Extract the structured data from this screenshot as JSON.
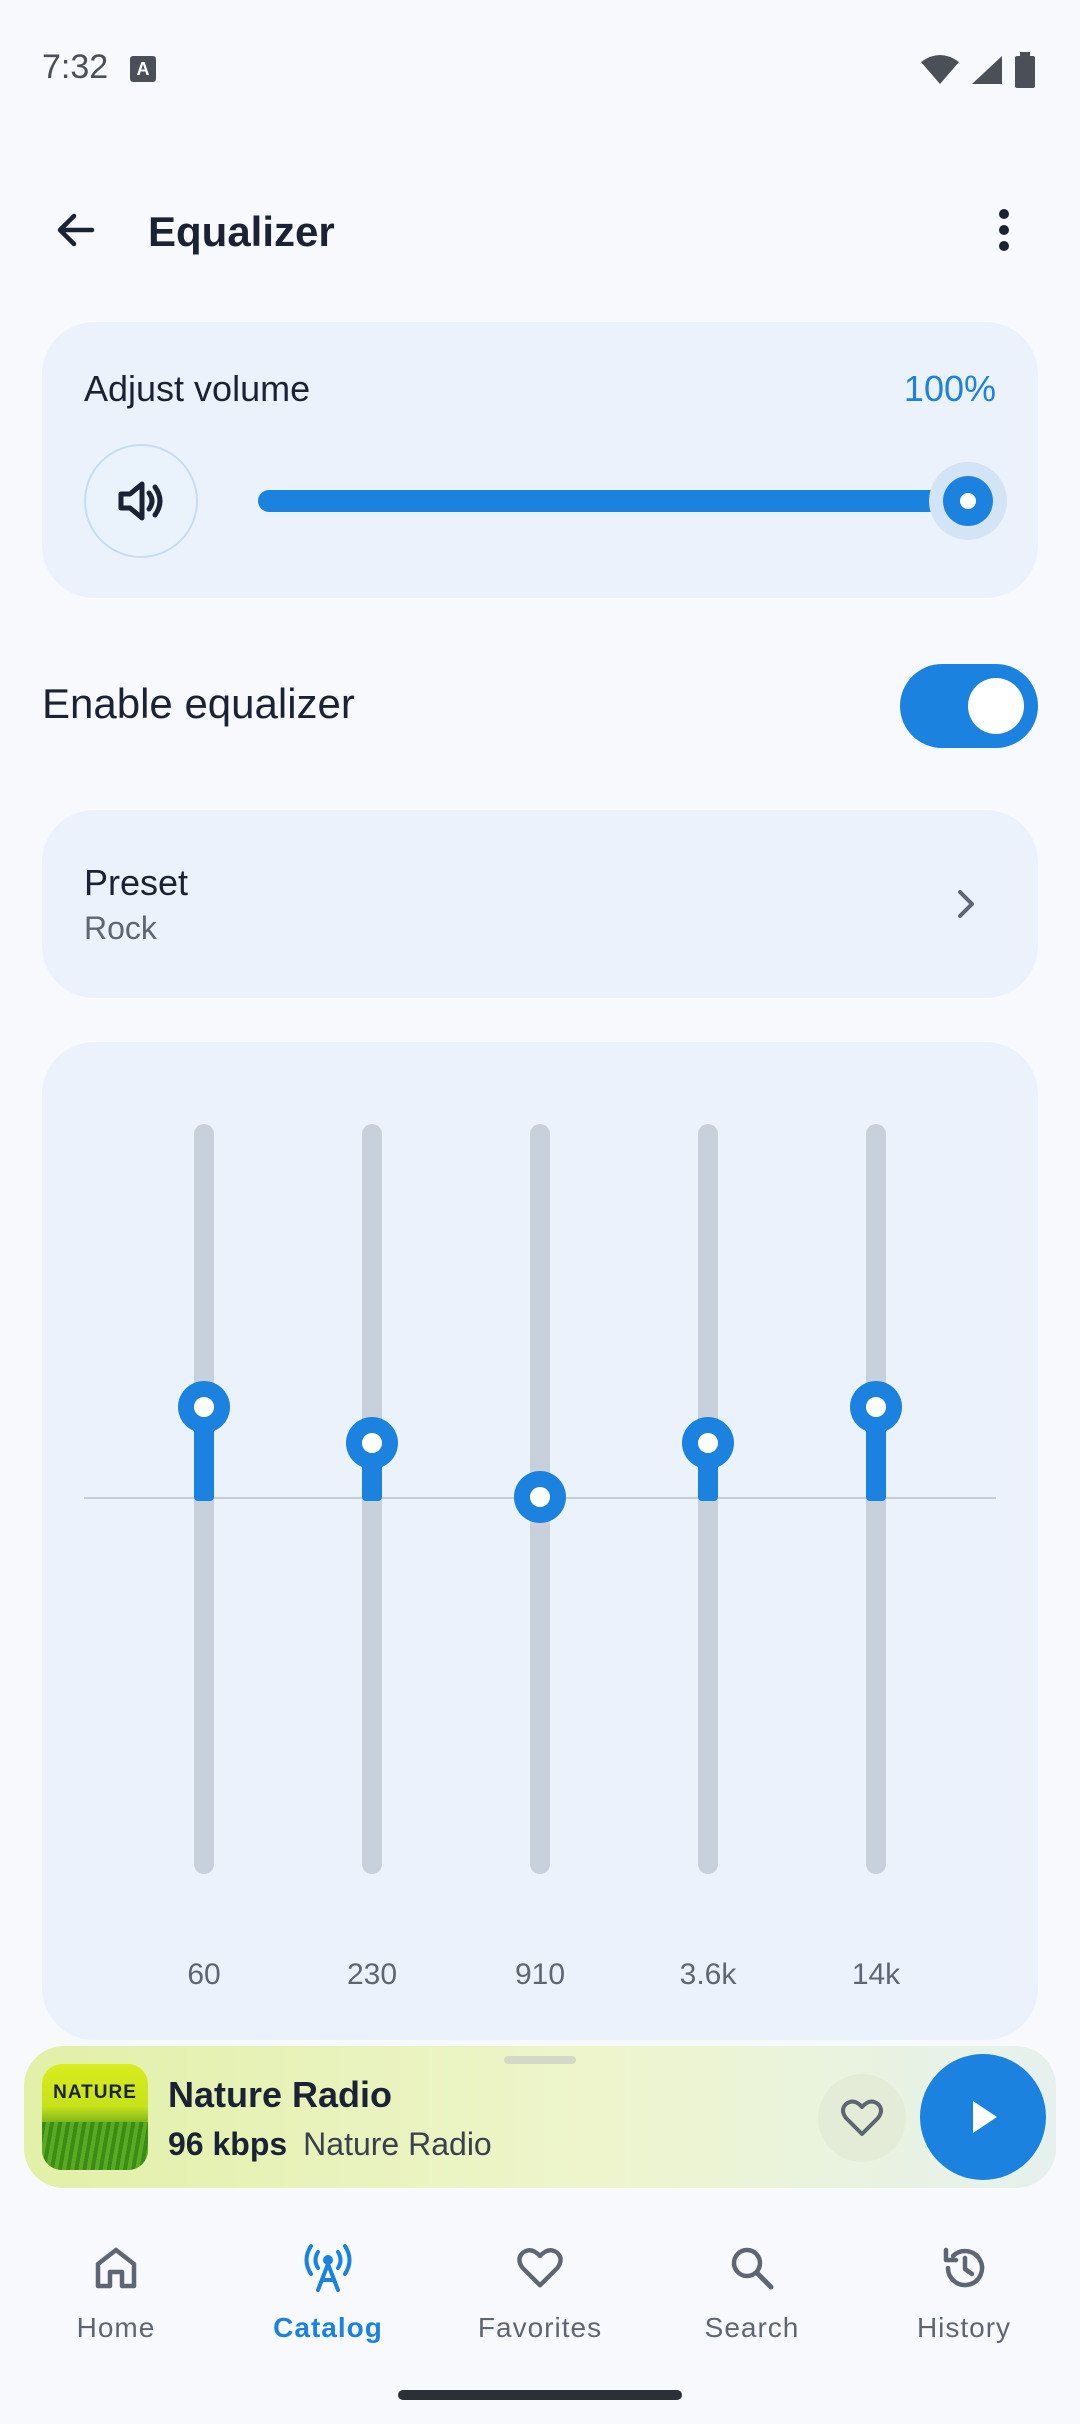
{
  "status_bar": {
    "time": "7:32",
    "notification_badge": "A"
  },
  "app_bar": {
    "title": "Equalizer"
  },
  "volume": {
    "label": "Adjust volume",
    "value_text": "100%",
    "level": 1.0
  },
  "equalizer_toggle": {
    "label": "Enable equalizer",
    "enabled": true
  },
  "preset": {
    "title": "Preset",
    "value": "Rock"
  },
  "bands": [
    {
      "label": "60",
      "level": 0.25
    },
    {
      "label": "230",
      "level": 0.15
    },
    {
      "label": "910",
      "level": 0.0
    },
    {
      "label": "3.6k",
      "level": 0.15
    },
    {
      "label": "14k",
      "level": 0.25
    }
  ],
  "player": {
    "artwork_text": "NATURE",
    "title": "Nature Radio",
    "bitrate": "96 kbps",
    "station": "Nature Radio"
  },
  "nav": {
    "items": [
      {
        "label": "Home",
        "icon": "home-icon",
        "active": false
      },
      {
        "label": "Catalog",
        "icon": "antenna-icon",
        "active": true
      },
      {
        "label": "Favorites",
        "icon": "heart-icon",
        "active": false
      },
      {
        "label": "Search",
        "icon": "search-icon",
        "active": false
      },
      {
        "label": "History",
        "icon": "history-icon",
        "active": false
      }
    ]
  },
  "colors": {
    "accent": "#1b82e0",
    "card": "#ecf2fc",
    "track": "#c8d0dc"
  }
}
